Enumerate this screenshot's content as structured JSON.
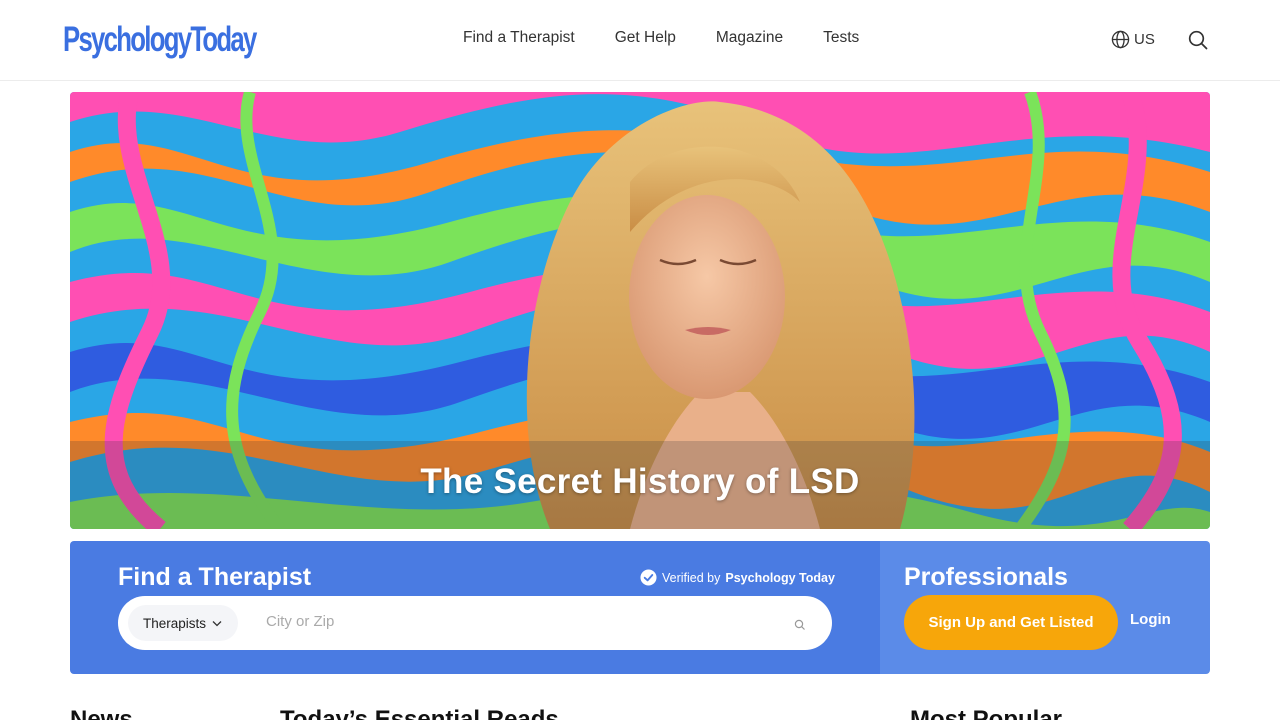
{
  "header": {
    "logo_text": "PsychologyToday",
    "nav": [
      "Find a Therapist",
      "Get Help",
      "Magazine",
      "Tests"
    ],
    "region_label": "US",
    "region_icon": "globe-icon",
    "search_icon": "search-icon"
  },
  "hero": {
    "title": "The Secret History of LSD"
  },
  "find_therapist": {
    "title": "Find a Therapist",
    "verified_prefix": "Verified by",
    "verified_brand": "Psychology Today",
    "type_select_value": "Therapists",
    "location_placeholder": "City or Zip"
  },
  "professionals": {
    "title": "Professionals",
    "signup_label": "Sign Up and Get Listed",
    "login_label": "Login"
  },
  "sections": {
    "news": "News",
    "essential_reads": "Today’s Essential Reads",
    "most_popular": "Most Popular"
  },
  "colors": {
    "brand_blue": "#3a6fe0",
    "panel_blue": "#4a7be2",
    "pro_blue": "#5b8be8",
    "accent_orange": "#f7a60a"
  }
}
